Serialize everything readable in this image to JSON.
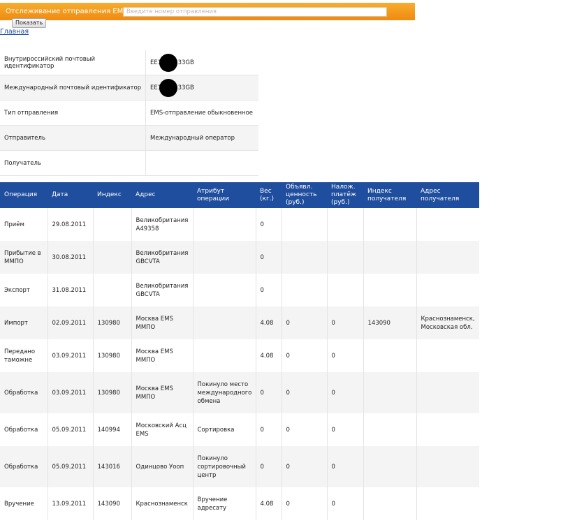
{
  "topbar": {
    "title": "Отслеживание отправления EMS",
    "search_placeholder": "Введите номер отправления",
    "show_button": "Показать"
  },
  "home_link": "Главная",
  "info": [
    {
      "label": "Внутрироссийский почтовый идентификатор",
      "value": "EE1",
      "value_suffix": "333GB",
      "redacted": true
    },
    {
      "label": "Международный почтовый идентификатор",
      "value": "EE1",
      "value_suffix": "333GB",
      "redacted": true
    },
    {
      "label": "Тип отправления",
      "value": "EMS-отправление обыкновенное"
    },
    {
      "label": "Отправитель",
      "value": "Международный оператор"
    },
    {
      "label": "Получатель",
      "value": ""
    }
  ],
  "ops": {
    "headers": [
      "Операция",
      "Дата",
      "Индекс",
      "Адрес",
      "Атрибут операции",
      "Вес (кг.)",
      "Объявл. ценность (руб.)",
      "Налож. платёж (руб.)",
      "Индекс получателя",
      "Адрес получателя"
    ],
    "rows": [
      [
        "Приём",
        "29.08.2011",
        "",
        "Великобритания A49358",
        "",
        "0",
        "",
        "",
        "",
        ""
      ],
      [
        "Прибытие в ММПО",
        "30.08.2011",
        "",
        "Великобритания GBCVTA",
        "",
        "0",
        "",
        "",
        "",
        ""
      ],
      [
        "Экспорт",
        "31.08.2011",
        "",
        "Великобритания GBCVTA",
        "",
        "0",
        "",
        "",
        "",
        ""
      ],
      [
        "Импорт",
        "02.09.2011",
        "130980",
        "Москва EMS ММПО",
        "",
        "4.08",
        "0",
        "0",
        "143090",
        "Краснознаменск, Московская обл."
      ],
      [
        "Передано таможне",
        "03.09.2011",
        "130980",
        "Москва EMS ММПО",
        "",
        "4.08",
        "0",
        "0",
        "",
        ""
      ],
      [
        "Обработка",
        "03.09.2011",
        "130980",
        "Москва EMS ММПО",
        "Покинуло место международного обмена",
        "0",
        "0",
        "0",
        "",
        ""
      ],
      [
        "Обработка",
        "05.09.2011",
        "140994",
        "Московский Асц EMS",
        "Сортировка",
        "0",
        "0",
        "0",
        "",
        ""
      ],
      [
        "Обработка",
        "05.09.2011",
        "143016",
        "Одинцово Уооп",
        "Покинуло сортировочный центр",
        "0",
        "0",
        "0",
        "",
        ""
      ],
      [
        "Вручение",
        "13.09.2011",
        "143090",
        "Краснознаменск",
        "Вручение адресату",
        "4.08",
        "0",
        "0",
        "",
        ""
      ]
    ]
  }
}
